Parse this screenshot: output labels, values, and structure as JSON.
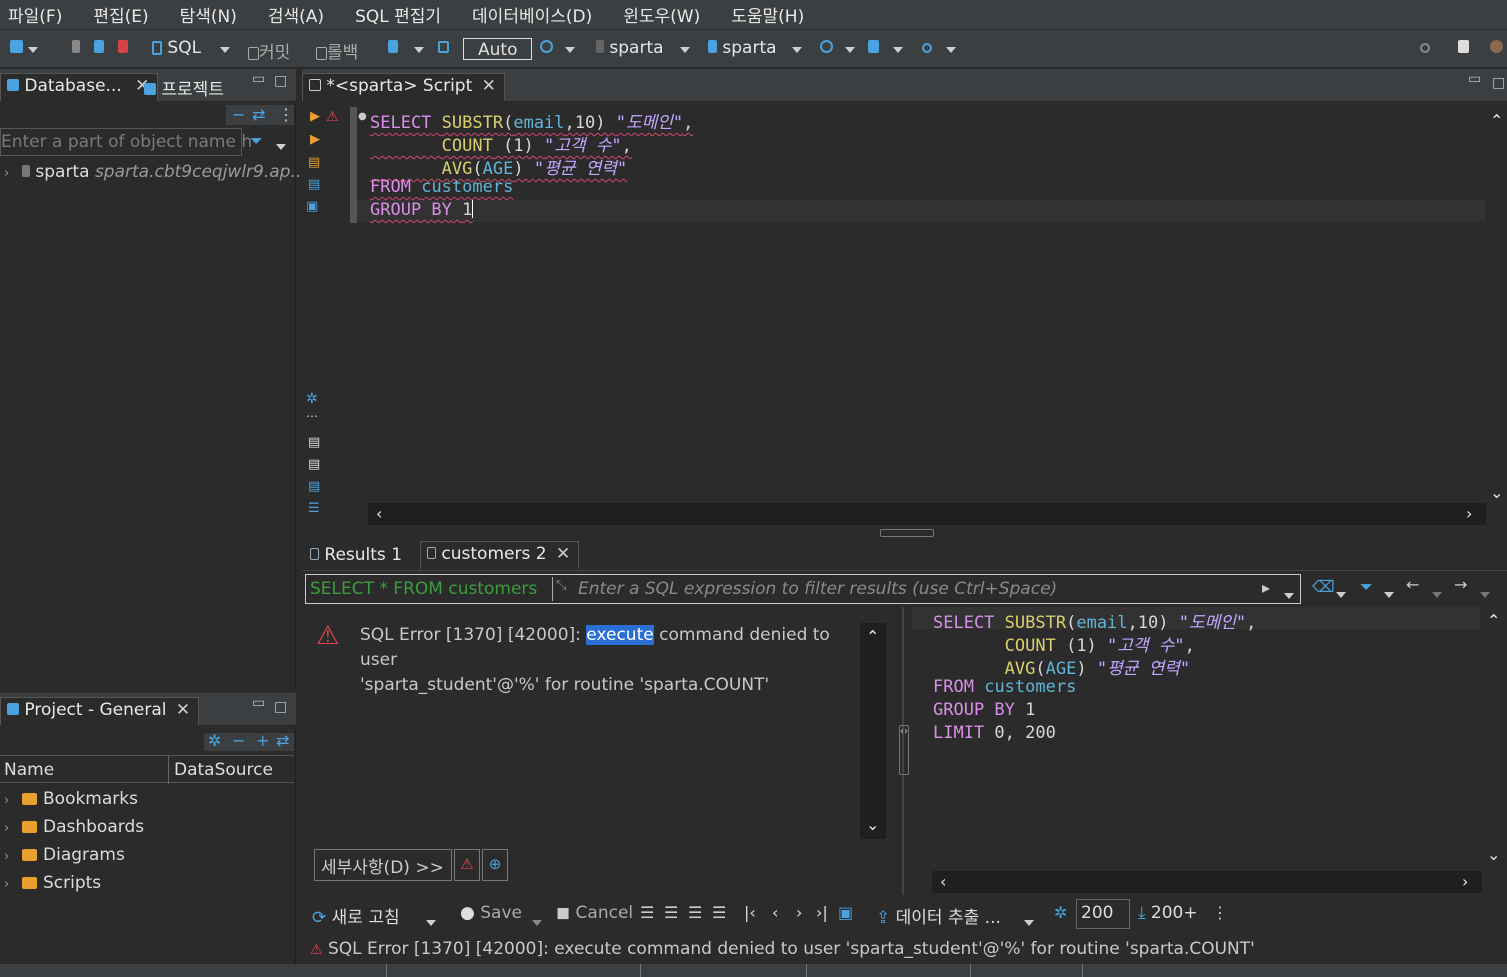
{
  "menu": [
    "파일(F)",
    "편집(E)",
    "탐색(N)",
    "검색(A)",
    "SQL 편집기",
    "데이터베이스(D)",
    "윈도우(W)",
    "도움말(H)"
  ],
  "toolbar": {
    "sql_label": "SQL",
    "commit_label": "커밋",
    "rollback_label": "롤백",
    "mode_label": "Auto",
    "datasource": "sparta",
    "schema": "sparta"
  },
  "dbnav": {
    "tab_database": "Database...",
    "tab_project": "프로젝트",
    "filter_placeholder": "Enter a part of object name h",
    "connection_name": "sparta",
    "connection_host": "sparta.cbt9ceqjwlr9.ap..."
  },
  "project": {
    "tab": "Project - General",
    "col_name": "Name",
    "col_datasource": "DataSource",
    "items": [
      "Bookmarks",
      "Dashboards",
      "Diagrams",
      "Scripts"
    ]
  },
  "editor": {
    "tab": "*<sparta> Script",
    "lines": [
      [
        "SELECT",
        "SUBSTR",
        "(",
        "email",
        ",10) ",
        "\"도메인\"",
        ","
      ],
      [
        "COUNT",
        " (1) ",
        "\"고객 수\"",
        ","
      ],
      [
        "AVG",
        "(",
        "AGE",
        ") ",
        "\"평균 연력\""
      ],
      [
        "FROM",
        "customers"
      ],
      [
        "GROUP BY",
        "1"
      ]
    ]
  },
  "results": {
    "tab1": "Results 1",
    "tab2": "customers 2",
    "filter_query": "SELECT * FROM customers",
    "filter_placeholder": "Enter a SQL expression to filter results (use Ctrl+Space)",
    "error_prefix": "SQL Error [1370] [42000]: ",
    "error_highlight": "execute",
    "error_rest": " command denied to user",
    "error_line2": "'sparta_student'@'%' for routine 'sparta.COUNT'",
    "details_button": "세부사항(D) >>",
    "query_lines": [
      [
        "SELECT",
        "SUBSTR",
        "(",
        "email",
        ",10) ",
        "\"도메인\"",
        ","
      ],
      [
        "COUNT",
        " (1) ",
        "\"고객 수\"",
        ","
      ],
      [
        "AVG",
        "(",
        "AGE",
        ") ",
        "\"평균 연력\""
      ],
      [
        "FROM",
        "customers"
      ],
      [
        "GROUP BY",
        "1"
      ],
      [
        "LIMIT",
        " 0, 200"
      ]
    ],
    "bottom": {
      "refresh": "새로 고침",
      "save": "Save",
      "cancel": "Cancel",
      "export": "데이터 추출 ...",
      "fetch_size": "200",
      "fetch_more": "200+"
    },
    "status_error": "SQL Error [1370] [42000]: execute command denied to user 'sparta_student'@'%' for routine 'sparta.COUNT'"
  },
  "colors": {
    "keyword": "#d98ee8",
    "function": "#d9cf6e",
    "column": "#61b4d6",
    "string": "#c1a7ff",
    "error_red": "#e0444f",
    "selection": "#2b6fd6"
  }
}
